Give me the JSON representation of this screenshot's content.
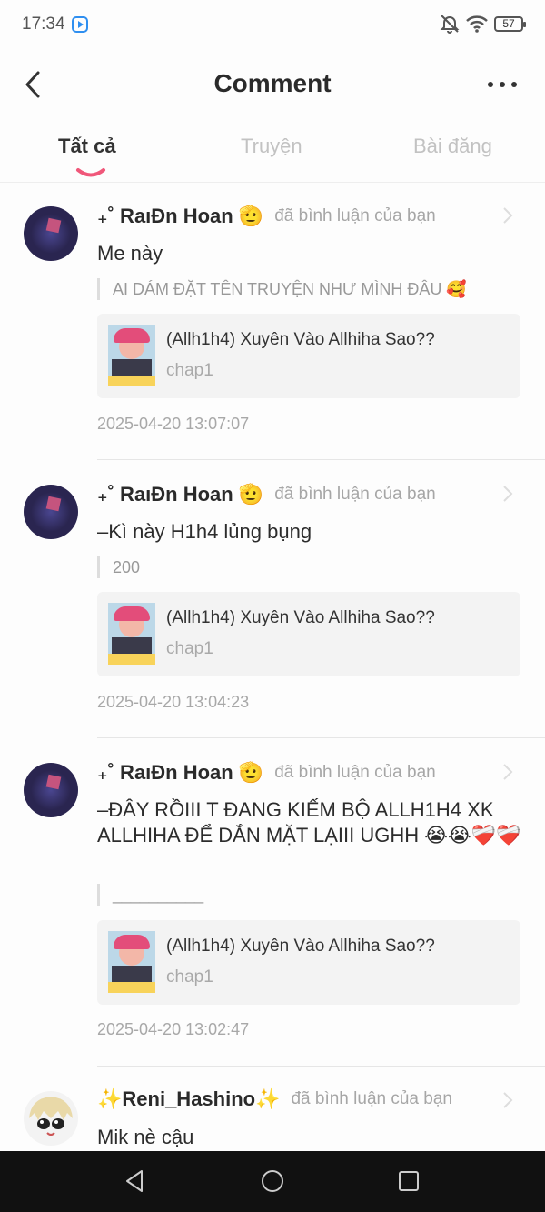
{
  "status": {
    "time": "17:34",
    "battery": "57"
  },
  "header": {
    "title": "Comment"
  },
  "tabs": [
    {
      "label": "Tất cả"
    },
    {
      "label": "Truyện"
    },
    {
      "label": "Bài đăng"
    }
  ],
  "comments": [
    {
      "user": "₊˚ RaıĐn Hoan 🫡",
      "action": "đã bình luận của bạn",
      "text": "Me này",
      "quote": "AI DÁM ĐẶT TÊN TRUYỆN NHƯ MÌNH ĐÂU 🥰",
      "story_title": "(Allh1h4) Xuyên Vào Allhiha Sao??",
      "chapter": "chap1",
      "timestamp": "2025-04-20 13:07:07"
    },
    {
      "user": "₊˚ RaıĐn Hoan 🫡",
      "action": "đã bình luận của bạn",
      "text": "–Kì này H1h4 lủng bụng",
      "quote": "200",
      "story_title": "(Allh1h4) Xuyên Vào Allhiha Sao??",
      "chapter": "chap1",
      "timestamp": "2025-04-20 13:04:23"
    },
    {
      "user": "₊˚ RaıĐn Hoan 🫡",
      "action": "đã bình luận của bạn",
      "text": "–ĐÂY RỒIII T ĐANG KIẾM BỘ ALLH1H4 XK ALLHIHA ĐỂ DẮN MẶT LẠIII UGHH 😭😭❤️‍🩹❤️‍🩹",
      "quote": "__________",
      "story_title": "(Allh1h4) Xuyên Vào Allhiha Sao??",
      "chapter": "chap1",
      "timestamp": "2025-04-20 13:02:47"
    },
    {
      "user": "✨Reni_Hashino✨",
      "action": "đã bình luận của bạn",
      "text": "Mik nè cậu"
    }
  ]
}
